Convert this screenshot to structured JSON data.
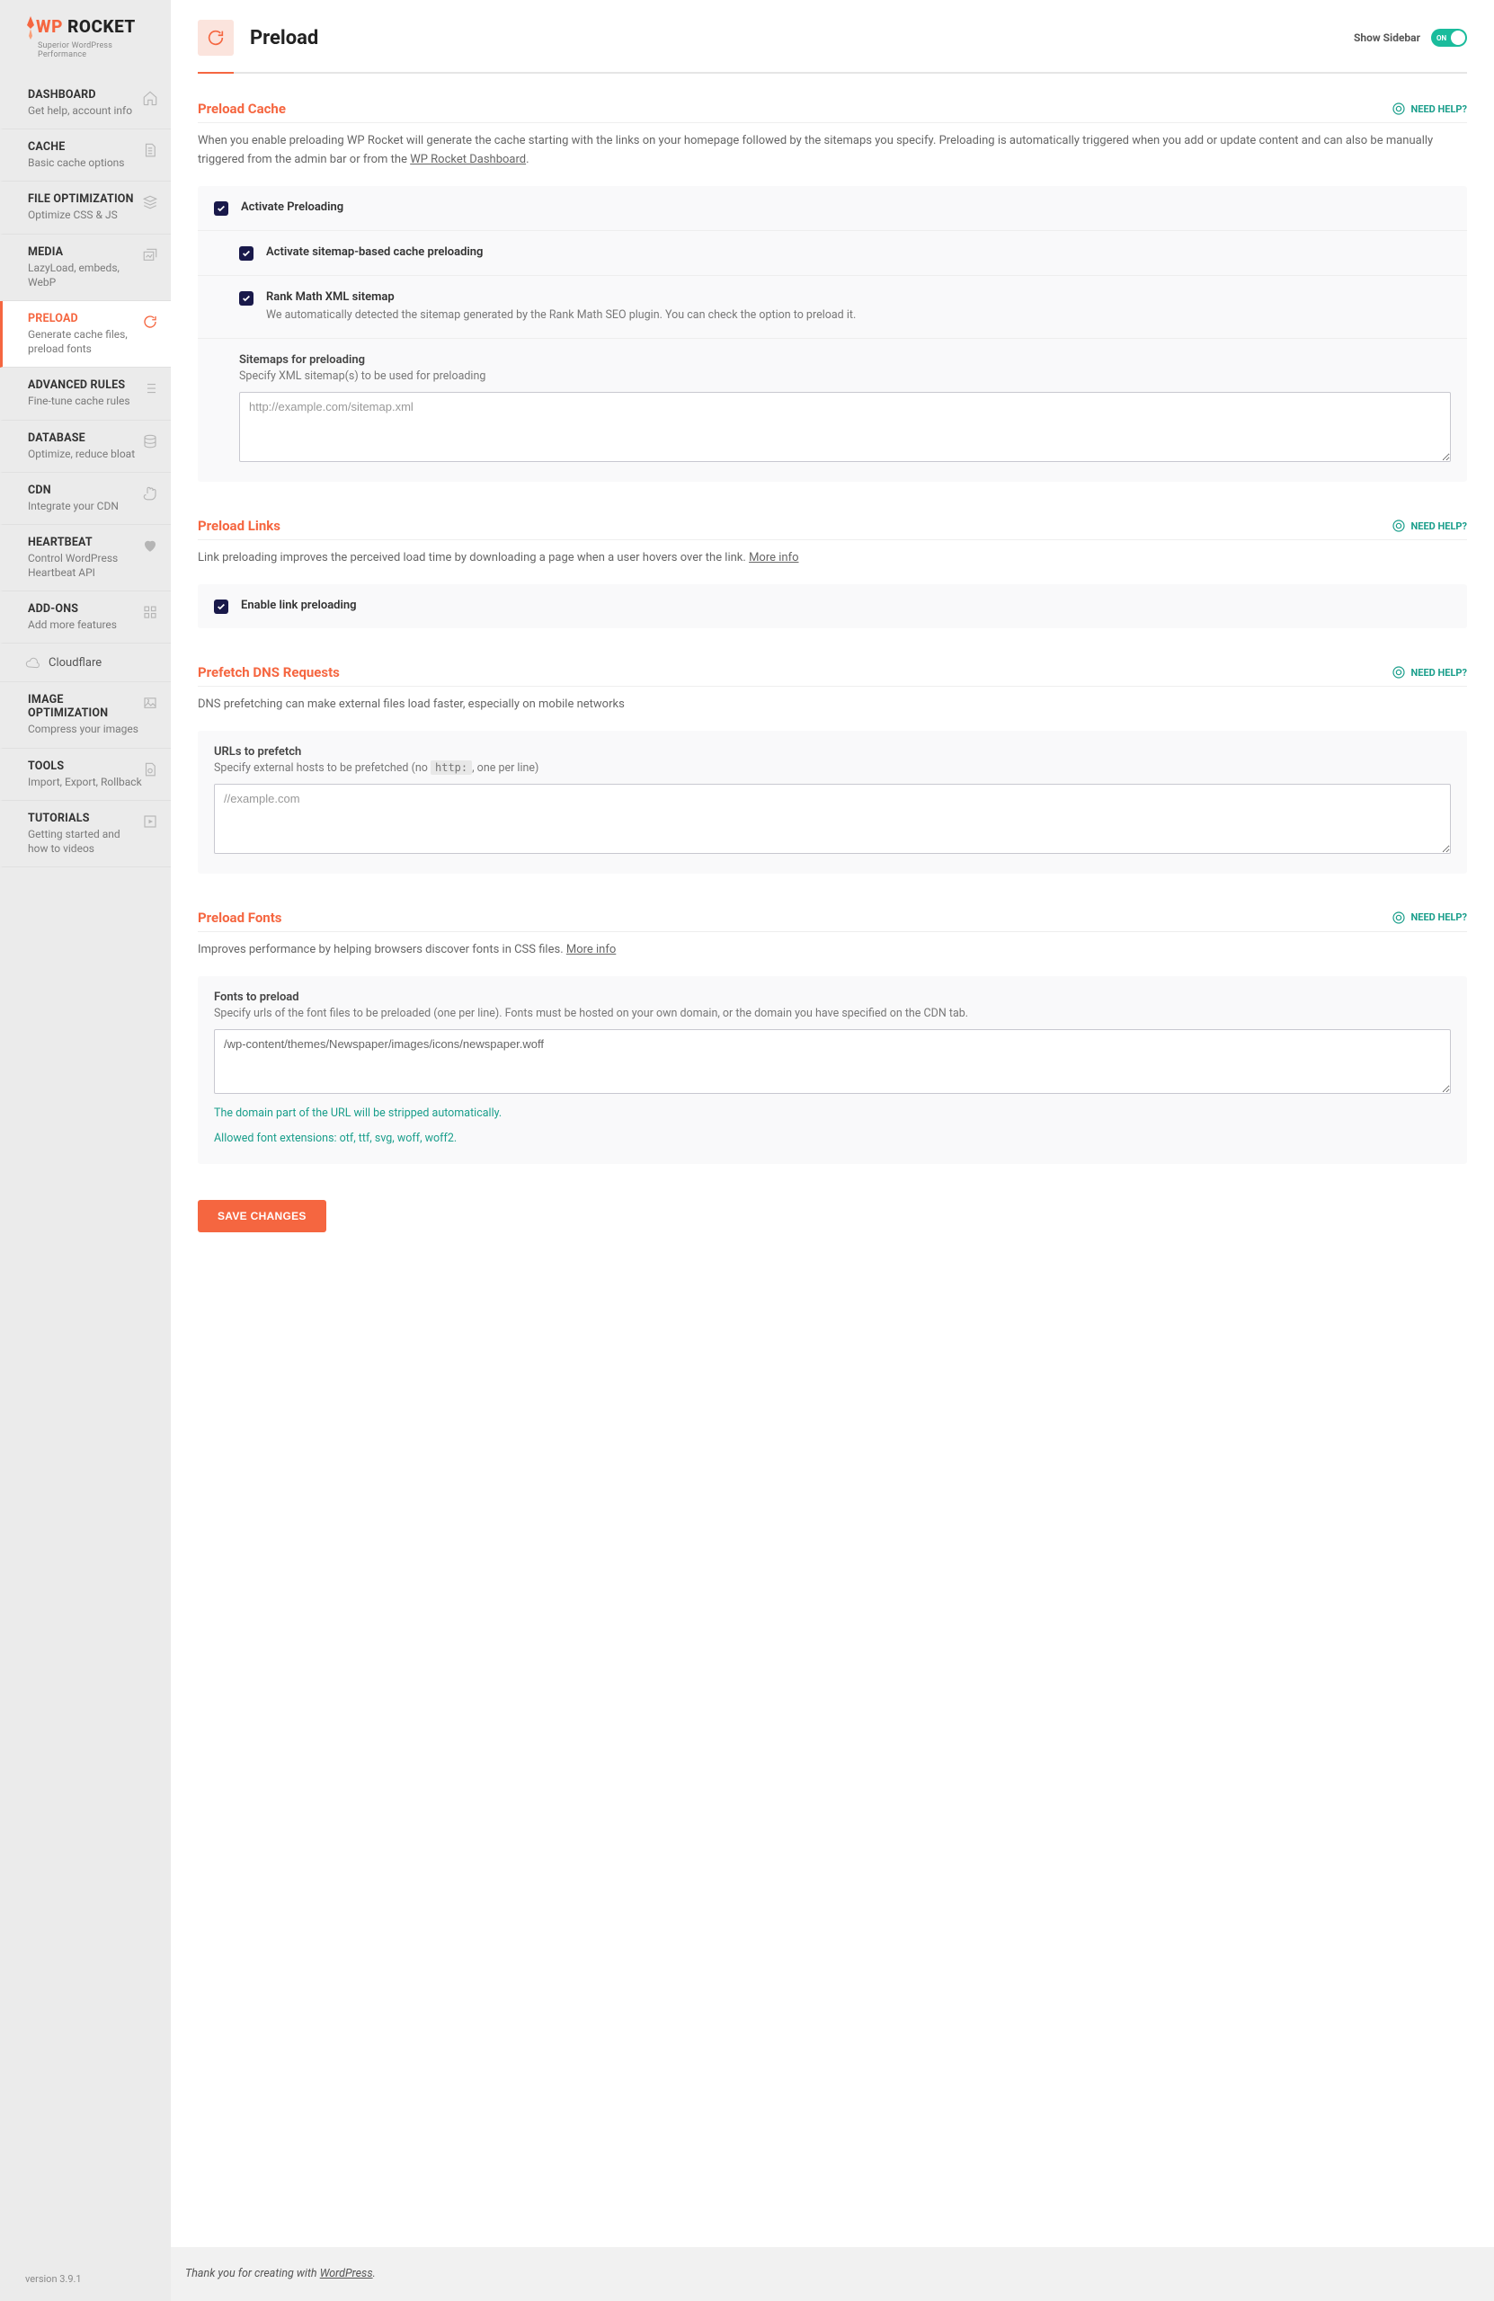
{
  "logo": {
    "part1": "WP",
    "part2": " ROCKET",
    "tagline": "Superior WordPress Performance"
  },
  "nav": [
    {
      "title": "DASHBOARD",
      "sub": "Get help, account info",
      "icon": "home"
    },
    {
      "title": "CACHE",
      "sub": "Basic cache options",
      "icon": "file"
    },
    {
      "title": "FILE OPTIMIZATION",
      "sub": "Optimize CSS & JS",
      "icon": "stack"
    },
    {
      "title": "MEDIA",
      "sub": "LazyLoad, embeds, WebP",
      "icon": "images"
    },
    {
      "title": "PRELOAD",
      "sub": "Generate cache files, preload fonts",
      "icon": "refresh",
      "active": true
    },
    {
      "title": "ADVANCED RULES",
      "sub": "Fine-tune cache rules",
      "icon": "list"
    },
    {
      "title": "DATABASE",
      "sub": "Optimize, reduce bloat",
      "icon": "db"
    },
    {
      "title": "CDN",
      "sub": "Integrate your CDN",
      "icon": "hand"
    },
    {
      "title": "HEARTBEAT",
      "sub": "Control WordPress Heartbeat API",
      "icon": "heart"
    },
    {
      "title": "ADD-ONS",
      "sub": "Add more features",
      "icon": "grid"
    }
  ],
  "cloudflare": "Cloudflare",
  "nav2": [
    {
      "title": "IMAGE OPTIMIZATION",
      "sub": "Compress your images",
      "icon": "image"
    },
    {
      "title": "TOOLS",
      "sub": "Import, Export, Rollback",
      "icon": "gear-file"
    },
    {
      "title": "TUTORIALS",
      "sub": "Getting started and how to videos",
      "icon": "play"
    }
  ],
  "version_label": "version 3.9.1",
  "header": {
    "title": "Preload",
    "show_sidebar": "Show Sidebar",
    "toggle_text": "ON"
  },
  "need_help_label": "NEED HELP?",
  "sections": {
    "preload_cache": {
      "title": "Preload Cache",
      "desc_pre": "When you enable preloading WP Rocket will generate the cache starting with the links on your homepage followed by the sitemaps you specify. Preloading is automatically triggered when you add or update content and can also be manually triggered from the admin bar or from the ",
      "desc_link": "WP Rocket Dashboard",
      "desc_post": ".",
      "opt_activate": "Activate Preloading",
      "opt_sitemap": "Activate sitemap-based cache preloading",
      "opt_rankmath": "Rank Math XML sitemap",
      "opt_rankmath_desc": "We automatically detected the sitemap generated by the Rank Math SEO plugin. You can check the option to preload it.",
      "sitemaps_title": "Sitemaps for preloading",
      "sitemaps_desc": "Specify XML sitemap(s) to be used for preloading",
      "sitemaps_placeholder": "http://example.com/sitemap.xml"
    },
    "preload_links": {
      "title": "Preload Links",
      "desc_pre": "Link preloading improves the perceived load time by downloading a page when a user hovers over the link. ",
      "desc_link": "More info",
      "opt_enable": "Enable link preloading"
    },
    "prefetch": {
      "title": "Prefetch DNS Requests",
      "desc": "DNS prefetching can make external files load faster, especially on mobile networks",
      "urls_title": "URLs to prefetch",
      "urls_desc_pre": "Specify external hosts to be prefetched (no ",
      "urls_desc_code": "http:",
      "urls_desc_post": ", one per line)",
      "urls_placeholder": "//example.com"
    },
    "preload_fonts": {
      "title": "Preload Fonts",
      "desc_pre": "Improves performance by helping browsers discover fonts in CSS files. ",
      "desc_link": "More info",
      "fonts_title": "Fonts to preload",
      "fonts_desc": "Specify urls of the font files to be preloaded (one per line). Fonts must be hosted on your own domain, or the domain you have specified on the CDN tab.",
      "fonts_value": "/wp-content/themes/Newspaper/images/icons/newspaper.woff",
      "hint1": "The domain part of the URL will be stripped automatically.",
      "hint2": "Allowed font extensions: otf, ttf, svg, woff, woff2."
    }
  },
  "save_button": "SAVE CHANGES",
  "footer": {
    "pre": "Thank you for creating with ",
    "link": "WordPress",
    "post": "."
  }
}
